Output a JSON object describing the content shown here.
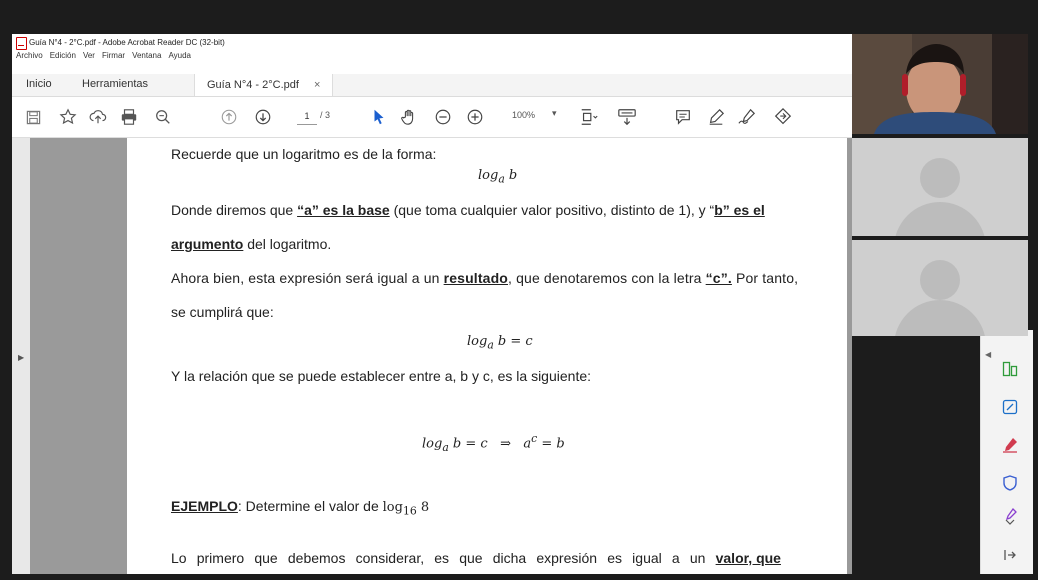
{
  "window": {
    "title": "Guía N°4 - 2°C.pdf - Adobe Acrobat Reader DC (32-bit)",
    "menu": [
      "Archivo",
      "Edición",
      "Ver",
      "Firmar",
      "Ventana",
      "Ayuda"
    ]
  },
  "tabs": {
    "home": "Inicio",
    "tools": "Herramientas",
    "document": "Guía N°4 - 2°C.pdf",
    "close": "×"
  },
  "toolbar": {
    "current_page": "1",
    "total_pages": "/ 3",
    "zoom": "100%",
    "zoom_caret": "▾"
  },
  "icons": {
    "save": "save-icon",
    "bookmark": "star-icon",
    "upload": "upload-icon",
    "print": "print-icon",
    "search": "search-icon"
  },
  "document": {
    "p1": "Recuerde que un logaritmo es de la forma:",
    "f1": "log",
    "f1_sub": "a",
    "f1_arg": " b",
    "p2_a": "Donde diremos que ",
    "p2_b": "“a” es la base",
    "p2_c": " (que toma cualquier valor positivo, distinto de 1), y “",
    "p2_d": "b” es el",
    "p3_a": "argumento",
    "p3_b": " del logaritmo.",
    "p4_a": "Ahora bien, esta expresión será igual a un ",
    "p4_b": "resultado",
    "p4_c": ", que denotaremos con la letra ",
    "p4_d": "“c”.",
    "p4_e": " Por tanto,",
    "p5": "se cumplirá que:",
    "f2": "log",
    "f2_sub": "a",
    "f2_arg": " b = c",
    "p6": "Y la relación que se puede establecer entre a, b y c, es la siguiente:",
    "f3_log": "log",
    "f3_sub": "a",
    "f3_rest": " b = c   ⇒   a",
    "f3_sup": "c",
    "f3_end": " = b",
    "ex_label": "EJEMPLO",
    "ex_text": ": Determine el valor de ",
    "ex_math": "log",
    "ex_sub": "16",
    "ex_arg": " 8",
    "p7_words": [
      "Lo",
      "primero",
      "que",
      "debemos",
      "considerar,",
      "es",
      "que",
      "dicha",
      "expresión",
      "es",
      "igual",
      "a",
      "un"
    ],
    "p7_end": "valor, que"
  },
  "colors": {
    "accent_pdf": "#c00000",
    "cursor_blue": "#1b5fcf",
    "rs_green": "#2e9b3a",
    "rs_teal": "#1b6fc8",
    "rs_red": "#d13b4f",
    "rs_shield": "#3a5fd1",
    "rs_purple": "#8a3fcf"
  }
}
